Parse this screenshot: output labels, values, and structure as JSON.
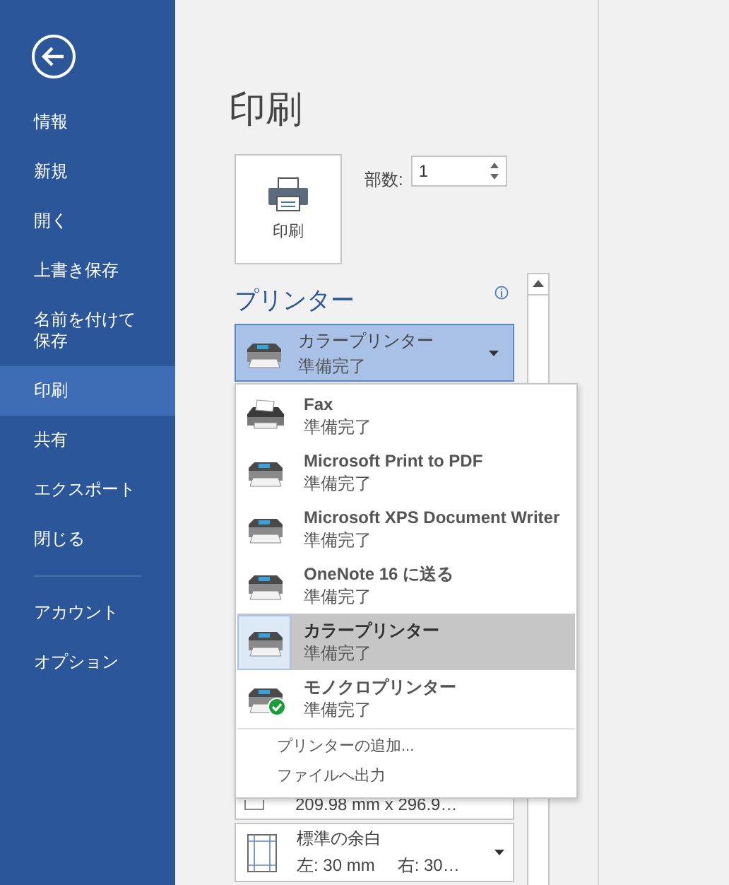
{
  "sidebar": {
    "items": [
      {
        "label": "情報",
        "selected": false
      },
      {
        "label": "新規",
        "selected": false
      },
      {
        "label": "開く",
        "selected": false
      },
      {
        "label": "上書き保存",
        "selected": false
      },
      {
        "label": "名前を付けて保存",
        "selected": false
      },
      {
        "label": "印刷",
        "selected": true
      },
      {
        "label": "共有",
        "selected": false
      },
      {
        "label": "エクスポート",
        "selected": false
      },
      {
        "label": "閉じる",
        "selected": false
      }
    ],
    "bottom_items": [
      {
        "label": "アカウント",
        "selected": false
      },
      {
        "label": "オプション",
        "selected": false
      }
    ]
  },
  "title": "印刷",
  "print_button": {
    "label": "印刷"
  },
  "copies": {
    "label": "部数:",
    "value": "1"
  },
  "printer": {
    "heading": "プリンター",
    "name": "カラープリンター",
    "status": "準備完了"
  },
  "printer_menu": {
    "printers": [
      {
        "name": "Fax",
        "status": "準備完了",
        "kind": "fax",
        "selected": false,
        "default": false
      },
      {
        "name": "Microsoft Print to PDF",
        "status": "準備完了",
        "kind": "printer",
        "selected": false,
        "default": false
      },
      {
        "name": "Microsoft XPS Document Writer",
        "status": "準備完了",
        "kind": "printer",
        "selected": false,
        "default": false
      },
      {
        "name": "OneNote 16 に送る",
        "status": "準備完了",
        "kind": "printer",
        "selected": false,
        "default": false
      },
      {
        "name": "カラープリンター",
        "status": "準備完了",
        "kind": "printer",
        "selected": true,
        "default": false
      },
      {
        "name": "モノクロプリンター",
        "status": "準備完了",
        "kind": "printer",
        "selected": false,
        "default": true
      }
    ],
    "actions": [
      "プリンターの追加...",
      "ファイルへ出力"
    ]
  },
  "settings": [
    {
      "kind": "paper",
      "detail": "209.98 mm x 296.9…"
    },
    {
      "kind": "margins",
      "title": "標準の余白",
      "left": "左: 30 mm",
      "right": "右: 30…"
    }
  ]
}
